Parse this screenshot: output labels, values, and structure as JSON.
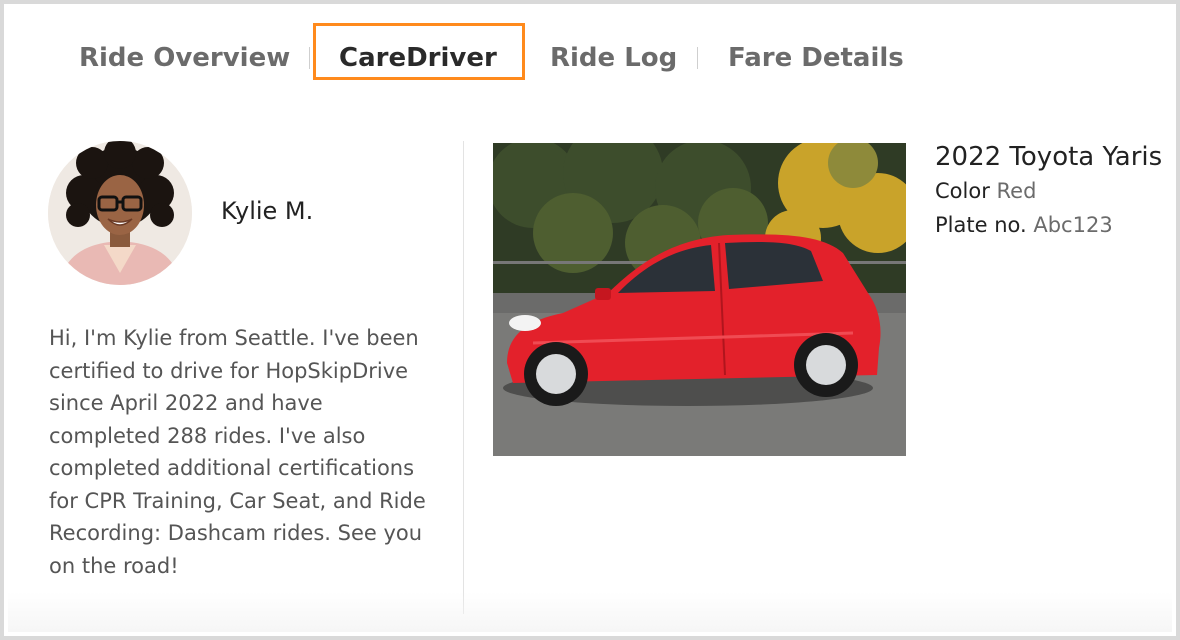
{
  "tabs": {
    "overview": "Ride Overview",
    "caredriver": "CareDriver",
    "ride_log": "Ride Log",
    "fare_details": "Fare Details",
    "active": "CareDriver"
  },
  "driver": {
    "name": "Kylie M.",
    "bio": "Hi, I'm Kylie from Seattle. I've been certified to drive for HopSkipDrive since April 2022 and have completed 288 rides. I've also completed additional certifications for CPR Training, Car Seat, and Ride Recording: Dashcam rides. See you on the road!"
  },
  "vehicle": {
    "title": "2022 Toyota Yaris",
    "color_label": "Color",
    "color_value": "Red",
    "plate_label": "Plate no.",
    "plate_value": "Abc123"
  },
  "colors": {
    "accent_highlight": "#ff8a1c",
    "car_body": "#e3212b"
  }
}
